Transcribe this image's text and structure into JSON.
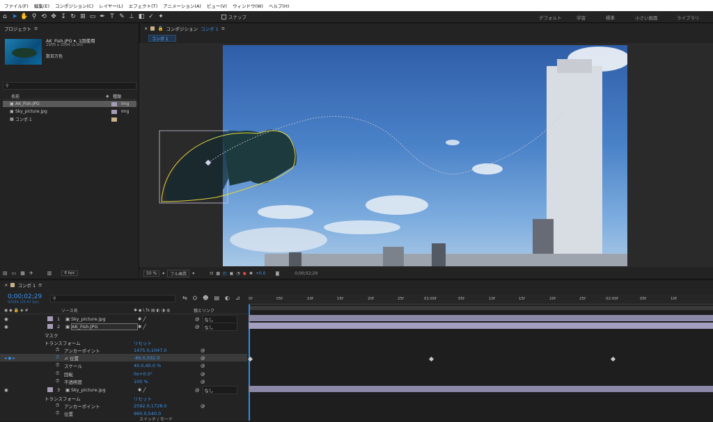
{
  "menu": [
    "ファイル(F)",
    "編集(E)",
    "コンポジション(C)",
    "レイヤー(L)",
    "エフェクト(T)",
    "アニメーション(A)",
    "ビュー(V)",
    "ウィンドウ(W)",
    "ヘルプ(H)"
  ],
  "toolbar": {
    "snap_label": "スナップ",
    "workspaces": [
      "デフォルト",
      "学習",
      "標準",
      "小さい画面",
      "ライブラリ"
    ]
  },
  "project": {
    "title": "プロジェクト",
    "file_name": "AK_Fish.JPG ▾, 1回使用",
    "file_dims": "2950 x 2094 (1.00)",
    "file_color": "数百万色",
    "col_name": "名前",
    "col_type": "種類",
    "items": [
      {
        "name": "AK_Fish.JPG",
        "type": "Img"
      },
      {
        "name": "Sky_picture.jpg",
        "type": "Img"
      },
      {
        "name": "コンポ 1",
        "type": ""
      }
    ],
    "bpc": "8 bpc"
  },
  "comp": {
    "title": "コンポジション",
    "comp_name": "コンポ 1",
    "tab": "コンポ 1",
    "zoom": "50 %",
    "resolution": "フル画質",
    "exposure": "+0.0",
    "timecode": "0;00;02;29"
  },
  "timeline": {
    "title": "コンポ 1",
    "timecode": "0;00;02;29",
    "frames": "00089 (29.97 fps)",
    "col_source": "ソース名",
    "col_parent": "親とリンク",
    "switches_label": "スイッチ / モード",
    "ruler": [
      "0f",
      "05f",
      "10f",
      "15f",
      "20f",
      "25f",
      "01:00f",
      "05f",
      "10f",
      "15f",
      "20f",
      "25f",
      "02:00f",
      "05f",
      "10f"
    ],
    "layers": [
      {
        "num": "1",
        "name": "Sky_picture.jpg",
        "parent": "なし"
      },
      {
        "num": "2",
        "name": "AK_Fish.JPG",
        "parent": "なし"
      },
      {
        "num": "3",
        "name": "Sky_picture.jpg",
        "parent": "なし"
      }
    ],
    "props": {
      "mask": "マスク",
      "transform": "トランスフォーム",
      "reset": "リセット",
      "anchor": "アンカーポイント",
      "anchor_val": "1475.0,1047.0",
      "position": "位置",
      "position_val": "-86.0,592.0",
      "scale": "スケール",
      "scale_val": "40.0,40.0 %",
      "rotation": "回転",
      "rotation_val": "0x+0.0°",
      "opacity": "不透明度",
      "opacity_val": "100 %",
      "anchor3_val": "2592.0,1728.0",
      "position3_val": "960.0,540.0"
    }
  }
}
